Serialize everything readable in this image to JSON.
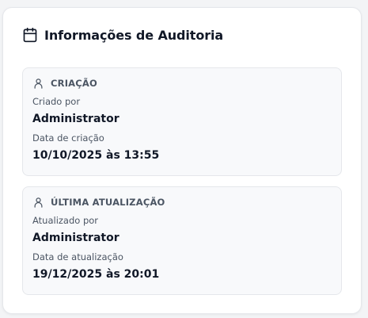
{
  "card": {
    "title": "Informações de Auditoria",
    "icon": "calendar-icon"
  },
  "creation": {
    "heading": "CRIAÇÃO",
    "icon": "user-icon",
    "created_by_label": "Criado por",
    "created_by_value": "Administrator",
    "created_date_label": "Data de criação",
    "created_date_value": "10/10/2025 às 13:55"
  },
  "update": {
    "heading": "ÚLTIMA ATUALIZAÇÃO",
    "icon": "user-icon",
    "updated_by_label": "Atualizado por",
    "updated_by_value": "Administrator",
    "updated_date_label": "Data de atualização",
    "updated_date_value": "19/12/2025 às 20:01"
  }
}
